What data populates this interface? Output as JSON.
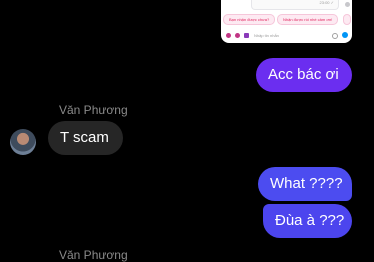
{
  "embedded_screenshot": {
    "time": "23:00 ✓",
    "chips": [
      "Bạn nhận được chưa?",
      "Nhận được rồi nhé cảm ơn!"
    ],
    "input_placeholder": "Nhập tin nhắn"
  },
  "messages": [
    {
      "direction": "outgoing",
      "text": "Acc bác ơi"
    },
    {
      "direction": "incoming",
      "sender": "Văn Phương",
      "text": "T scam"
    },
    {
      "direction": "outgoing",
      "text": "What ????"
    },
    {
      "direction": "outgoing",
      "text": "Đùa à ???"
    }
  ],
  "next_sender": "Văn Phương",
  "colors": {
    "background": "#000000",
    "outgoing_bubble": "#5b3ef0",
    "incoming_bubble": "#262626",
    "sender_name": "#8a8a8a"
  }
}
